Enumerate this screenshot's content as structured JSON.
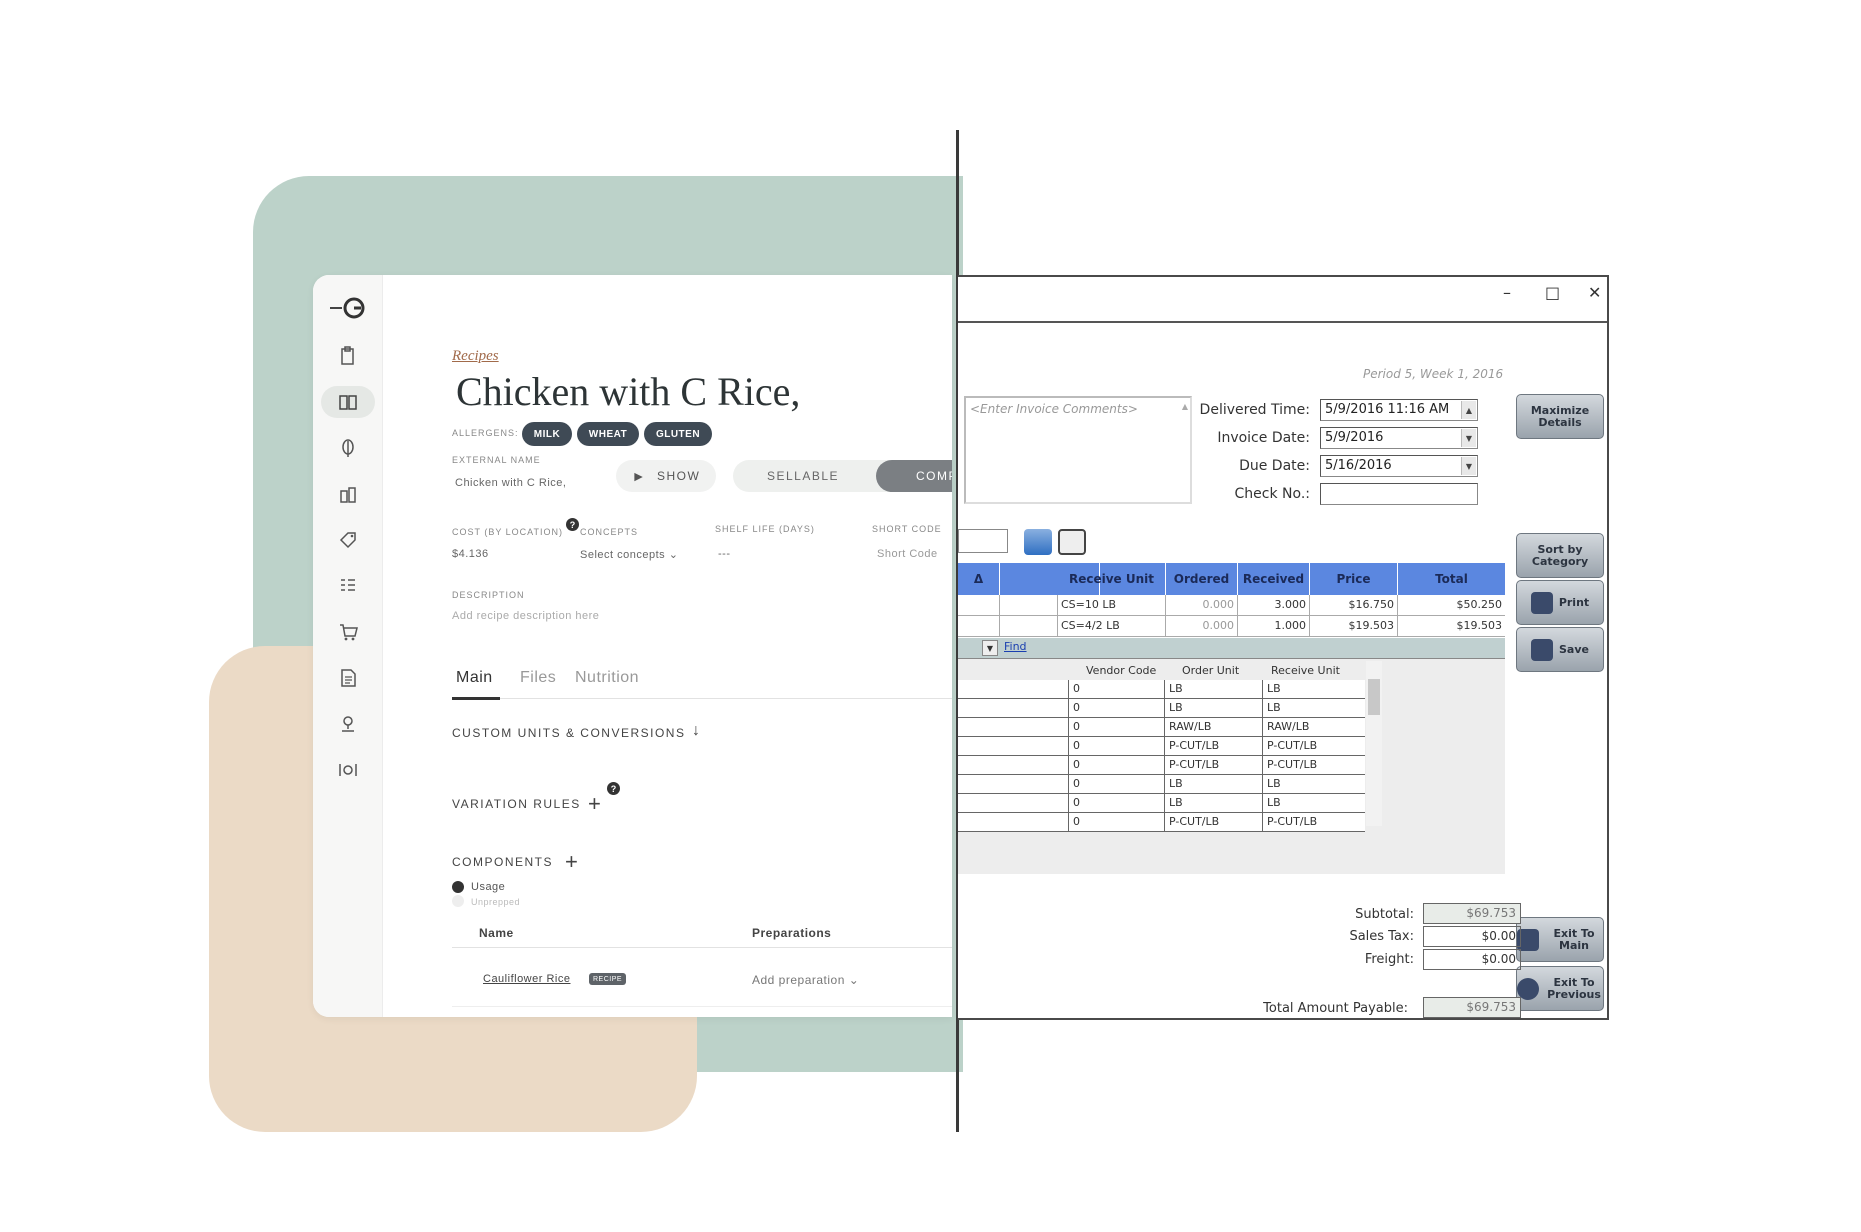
{
  "recipe_app": {
    "breadcrumb": "Recipes",
    "title": "Chicken with C Rice,",
    "allergens_label": "ALLERGENS:",
    "allergens": [
      "MILK",
      "WHEAT",
      "GLUTEN"
    ],
    "external_name_label": "EXTERNAL NAME",
    "external_name_value": "Chicken with C Rice,",
    "show_label": "SHOW",
    "toggle_sellable": "SELLABLE",
    "toggle_component": "COMP",
    "cost_label": "COST (BY LOCATION)",
    "cost_value": "$4.136",
    "concepts_label": "CONCEPTS",
    "concepts_value": "Select concepts",
    "shelf_life_label": "SHELF LIFE (DAYS)",
    "shelf_life_value": "---",
    "short_code_label": "SHORT CODE",
    "short_code_value": "Short Code",
    "description_label": "DESCRIPTION",
    "description_placeholder": "Add recipe description here",
    "tabs": [
      "Main",
      "Files",
      "Nutrition"
    ],
    "custom_units_label": "CUSTOM UNITS & CONVERSIONS",
    "variation_rules_label": "VARIATION RULES",
    "components_label": "COMPONENTS",
    "radio_usage": "Usage",
    "radio_unprepped": "Unprepped",
    "table_cols": [
      "Name",
      "Preparations"
    ],
    "row_name": "Cauliflower Rice",
    "row_badge": "RECIPE",
    "row_prep": "Add preparation",
    "help_glyph": "?"
  },
  "invoice_window": {
    "controls": [
      "–",
      "□",
      "✕"
    ],
    "period": "Period 5, Week 1, 2016",
    "comments_placeholder": "<Enter Invoice Comments>",
    "delivered_time_label": "Delivered Time:",
    "delivered_time_value": "5/9/2016 11:16 AM",
    "invoice_date_label": "Invoice Date:",
    "invoice_date_value": "5/9/2016",
    "due_date_label": "Due Date:",
    "due_date_value": "5/16/2016",
    "check_no_label": "Check No.:",
    "check_no_value": "",
    "buttons": {
      "maximize": "Maximize Details",
      "sort": "Sort by Category",
      "print": "Print",
      "save": "Save",
      "exit_main": "Exit To Main",
      "exit_prev": "Exit To Previous"
    },
    "grid_headers": [
      "Δ",
      "",
      "Receive Unit",
      "Ordered",
      "Received",
      "Price",
      "Total"
    ],
    "grid_rows": [
      {
        "unit": "CS=10 LB",
        "ordered": "0.000",
        "received": "3.000",
        "price": "$16.750",
        "total": "$50.250"
      },
      {
        "unit": "CS=4/2 LB",
        "ordered": "0.000",
        "received": "1.000",
        "price": "$19.503",
        "total": "$19.503"
      }
    ],
    "find_label": "Find",
    "sub_headers": [
      "Vendor Code",
      "Order Unit",
      "Receive Unit"
    ],
    "sub_rows": [
      {
        "code": "0",
        "order": "LB",
        "receive": "LB"
      },
      {
        "code": "0",
        "order": "LB",
        "receive": "LB"
      },
      {
        "code": "0",
        "order": "RAW/LB",
        "receive": "RAW/LB"
      },
      {
        "code": "0",
        "order": "P-CUT/LB",
        "receive": "P-CUT/LB"
      },
      {
        "code": "0",
        "order": "P-CUT/LB",
        "receive": "P-CUT/LB"
      },
      {
        "code": "0",
        "order": "LB",
        "receive": "LB"
      },
      {
        "code": "0",
        "order": "LB",
        "receive": "LB"
      },
      {
        "code": "0",
        "order": "P-CUT/LB",
        "receive": "P-CUT/LB"
      }
    ],
    "subtotal_label": "Subtotal:",
    "subtotal_value": "$69.753",
    "sales_tax_label": "Sales Tax:",
    "sales_tax_value": "$0.00",
    "freight_label": "Freight:",
    "freight_value": "$0.00",
    "total_label": "Total Amount Payable:",
    "total_value": "$69.753"
  }
}
